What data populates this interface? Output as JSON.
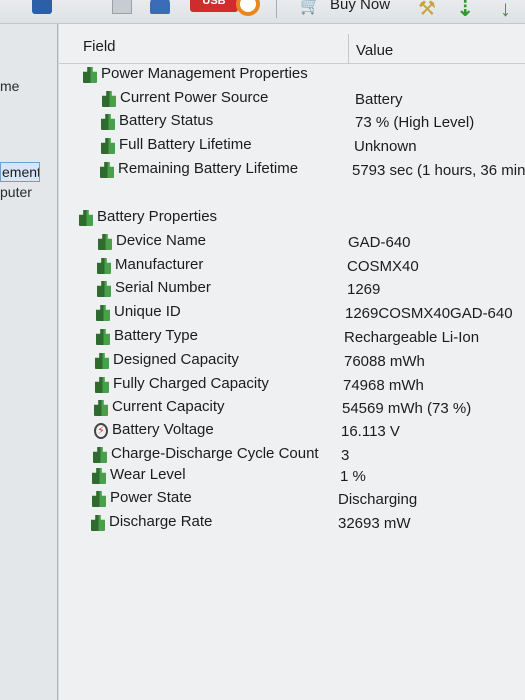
{
  "toolbar": {
    "usb_label": "USB",
    "buy_now_label": "Buy Now",
    "icons": [
      "report-icon",
      "document-icon",
      "cloud-icon",
      "usb-icon",
      "circle-icon",
      "cart-icon",
      "tools-icon",
      "download-arrow-icon",
      "down-arrow-icon"
    ]
  },
  "left_pane": {
    "item_top": "me",
    "item_selected": "ement",
    "item_bottom": "puter"
  },
  "table": {
    "col_field": "Field",
    "col_value": "Value"
  },
  "sections": {
    "power": {
      "title": "Power Management Properties",
      "rows": [
        {
          "field": "Current Power Source",
          "value": "Battery"
        },
        {
          "field": "Battery Status",
          "value": "73 % (High Level)"
        },
        {
          "field": "Full Battery Lifetime",
          "value": "Unknown"
        },
        {
          "field": "Remaining Battery Lifetime",
          "value": "5793 sec (1 hours, 36 min,"
        }
      ]
    },
    "battery": {
      "title": "Battery Properties",
      "rows": [
        {
          "field": "Device Name",
          "value": "GAD-640"
        },
        {
          "field": "Manufacturer",
          "value": "COSMX40"
        },
        {
          "field": "Serial Number",
          "value": "1269"
        },
        {
          "field": "Unique ID",
          "value": "1269COSMX40GAD-640"
        },
        {
          "field": "Battery Type",
          "value": "Rechargeable Li-Ion"
        },
        {
          "field": "Designed Capacity",
          "value": "76088 mWh"
        },
        {
          "field": "Fully Charged Capacity",
          "value": "74968 mWh"
        },
        {
          "field": "Current Capacity",
          "value": "54569 mWh  (73 %)"
        },
        {
          "field": "Battery Voltage",
          "value": "16.113 V"
        },
        {
          "field": "Charge-Discharge Cycle Count",
          "value": "3"
        },
        {
          "field": "Wear Level",
          "value": "1 %"
        },
        {
          "field": "Power State",
          "value": "Discharging"
        },
        {
          "field": "Discharge Rate",
          "value": "32693 mW"
        }
      ]
    }
  },
  "colors": {
    "background": "#eef0f1",
    "icon_green": "#3f8f3f",
    "selection": "#d6e6f7"
  }
}
